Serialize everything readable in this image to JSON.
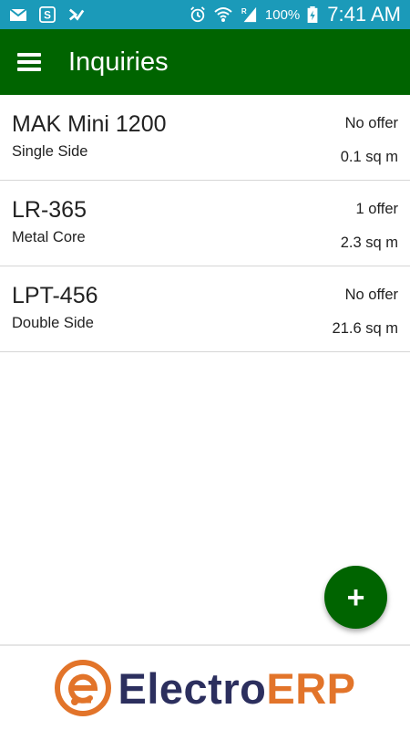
{
  "status_bar": {
    "battery_percent": "100%",
    "time": "7:41 AM",
    "icons": [
      "mail-icon",
      "skype-icon",
      "check-icon",
      "alarm-icon",
      "wifi-icon",
      "signal-icon",
      "battery-icon"
    ]
  },
  "app_bar": {
    "title": "Inquiries",
    "menu_icon": "hamburger-menu-icon"
  },
  "inquiries": [
    {
      "name": "MAK Mini 1200",
      "type": "Single Side",
      "offer": "No offer",
      "area": "0.1 sq m"
    },
    {
      "name": "LR-365",
      "type": "Metal Core",
      "offer": "1 offer",
      "area": "2.3 sq m"
    },
    {
      "name": "LPT-456",
      "type": "Double Side",
      "offer": "No offer",
      "area": "21.6 sq m"
    }
  ],
  "fab": {
    "icon": "plus-icon",
    "label": "+"
  },
  "footer": {
    "logo_text_part1": "Electro",
    "logo_text_part2": "ERP"
  },
  "colors": {
    "status_bar": "#1b9ab9",
    "app_bar": "#006400",
    "fab": "#006400",
    "logo_dark": "#2c2f5e",
    "logo_orange": "#e2742a"
  }
}
